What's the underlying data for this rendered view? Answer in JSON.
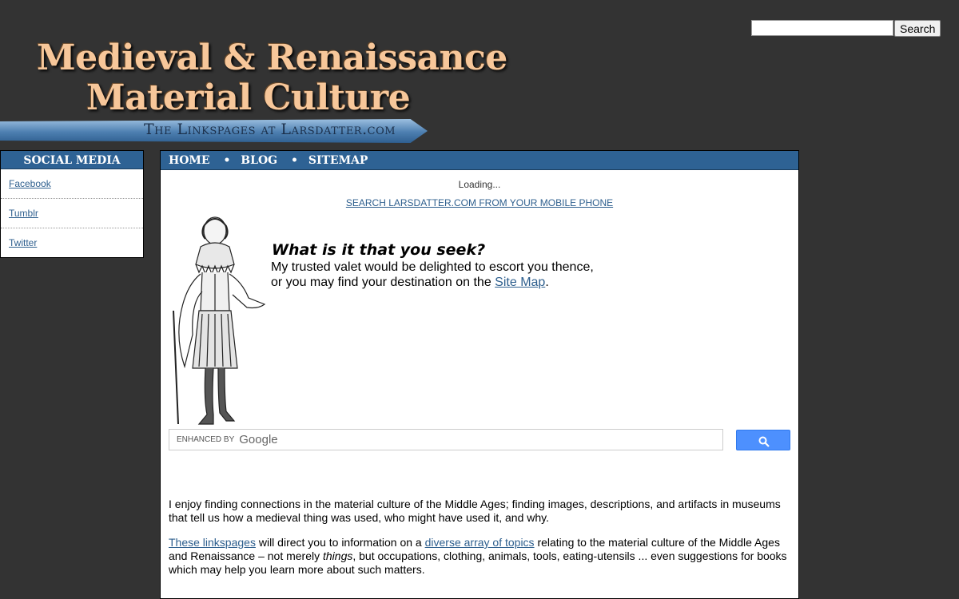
{
  "top_search": {
    "placeholder": "",
    "button_label": "Search"
  },
  "logo": {
    "line1": "Medieval & Renaissance",
    "line2": "Material Culture",
    "banner": "The Linkspages at Larsdatter.com"
  },
  "sidebar": {
    "title": "SOCIAL MEDIA",
    "items": [
      {
        "label": "Facebook"
      },
      {
        "label": "Tumblr"
      },
      {
        "label": "Twitter"
      }
    ]
  },
  "nav": {
    "items": [
      {
        "label": "HOME"
      },
      {
        "label": "BLOG"
      },
      {
        "label": "SITEMAP"
      }
    ],
    "separator": "•"
  },
  "main": {
    "loading": "Loading...",
    "mobile_link": "SEARCH LARSDATTER.COM FROM YOUR MOBILE PHONE",
    "seek_title": "What is it that you seek?",
    "seek_line1": "My trusted valet would be delighted to escort you thence,",
    "seek_line2_pre": "or you may find your destination on the ",
    "seek_link": "Site Map",
    "seek_line2_post": ".",
    "google_enhanced": "ENHANCED BY",
    "google_brand": "Google",
    "google_search_icon": "magnifier-icon",
    "p1": "I enjoy finding connections in the material culture of the Middle Ages; finding images, descriptions, and artifacts in museums that tell us how a medieval thing was used, who might have used it, and why.",
    "p2_link1": "These linkspages",
    "p2_text1": " will direct you to information on a ",
    "p2_link2": "diverse array of topics",
    "p2_text2": " relating to the material culture of the Middle Ages and Renaissance – not merely ",
    "p2_em": "things",
    "p2_text3": ", but occupations, clothing, animals, tools, eating-utensils ... even suggestions for books which may help you learn more about such matters."
  },
  "colors": {
    "background": "#333333",
    "accent": "#2e6294",
    "link": "#2e5f8e",
    "logo_text": "#f7c79a"
  }
}
